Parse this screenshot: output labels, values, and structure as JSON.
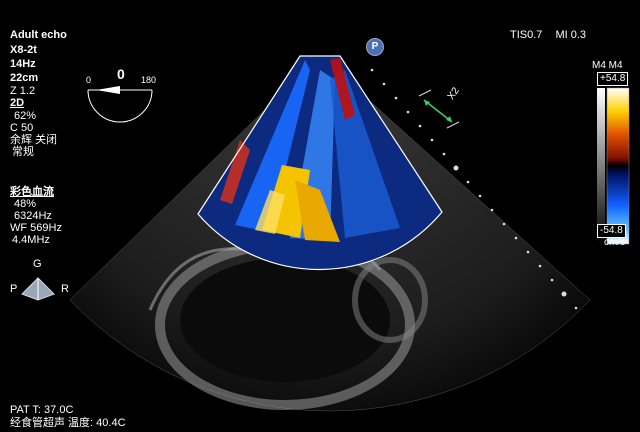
{
  "header": {
    "preset": "Adult echo",
    "probe": "X8-2t",
    "frame_rate": "14Hz",
    "depth": "22cm",
    "zoom": "Z 1.2",
    "tis": "TIS0.7",
    "mi": "MI 0.3"
  },
  "angle_dial": {
    "min_label": "0",
    "max_label": "180",
    "value": "0"
  },
  "mode_2d": {
    "label": "2D",
    "gain": "62%",
    "compress": "C 50",
    "line1": "余辉 关闭",
    "line2": "常规"
  },
  "color_flow": {
    "label": "彩色血流",
    "gain": "48%",
    "prf": "6324Hz",
    "wall_filter": "WF 569Hz",
    "freq": "4.4MHz"
  },
  "orientation": {
    "top": "G",
    "left": "P",
    "right": "R"
  },
  "scale": {
    "label": "X2"
  },
  "colorbar": {
    "mode": "M4 M4",
    "max": "+54.8",
    "min": "-54.8",
    "unit": "cm/s"
  },
  "probe_marker": "P",
  "footer": {
    "pat_temp": "PAT T: 37.0C",
    "probe_temp": "经食管超声 温度: 40.4C"
  },
  "colors": {
    "flow_blue": "#1a6bff",
    "flow_yellow": "#f5c400",
    "flow_red": "#c01010",
    "accent_green": "#3cd070"
  }
}
